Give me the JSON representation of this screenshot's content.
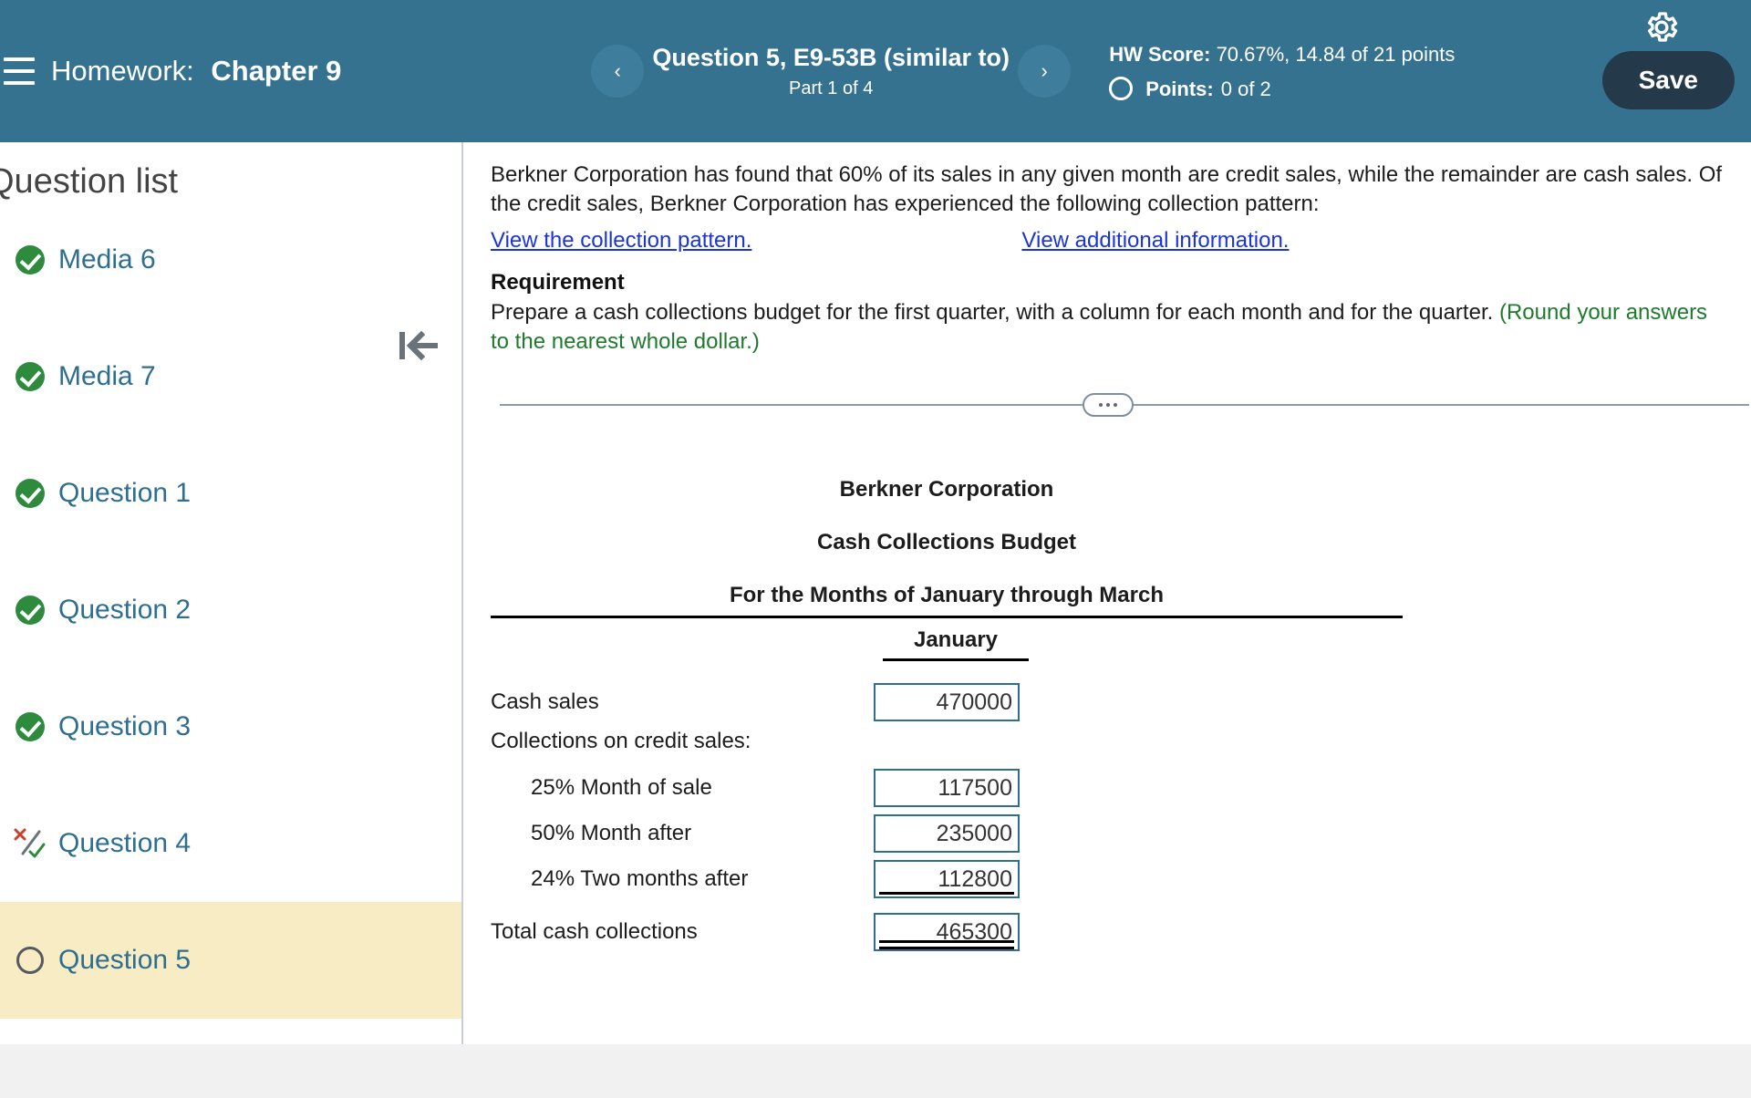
{
  "header": {
    "menu_icon": "hamburger-icon",
    "assignment_prefix": "Homework:",
    "assignment_name": "Chapter 9",
    "prev_icon": "chevron-left-icon",
    "next_icon": "chevron-right-icon",
    "question_title": "Question 5, E9-53B (similar to)",
    "question_part": "Part 1 of 4",
    "hw_score_label": "HW Score:",
    "hw_score_value": "70.67%, 14.84 of 21 points",
    "points_label": "Points:",
    "points_value": "0 of 2",
    "points_status_icon": "empty-circle-icon",
    "settings_icon": "gear-icon",
    "save_label": "Save",
    "bar_color": "#357290",
    "save_color": "#24394a"
  },
  "sidebar": {
    "title": "Question list",
    "collapse_icon": "collapse-panel-left-icon",
    "items": [
      {
        "label": "Media 6",
        "status": "correct",
        "active": false
      },
      {
        "label": "Media 7",
        "status": "correct",
        "active": false
      },
      {
        "label": "Question 1",
        "status": "correct",
        "active": false
      },
      {
        "label": "Question 2",
        "status": "correct",
        "active": false
      },
      {
        "label": "Question 3",
        "status": "correct",
        "active": false
      },
      {
        "label": "Question 4",
        "status": "partial",
        "active": false
      },
      {
        "label": "Question 5",
        "status": "unanswered",
        "active": true
      }
    ],
    "active_highlight_color": "#f7ecc4",
    "link_color": "#2e6e91",
    "correct_color": "#2e8b3d"
  },
  "question": {
    "prompt": "Berkner Corporation has found that 60% of its sales in any given month are credit sales, while the remainder are cash sales. Of the credit sales, Berkner Corporation has experienced the following collection pattern:",
    "link_1": "View the collection pattern.",
    "link_2": "View additional information.",
    "requirement_heading": "Requirement",
    "requirement_text": "Prepare a cash collections budget for the first quarter, with a column for each month and for the quarter. ",
    "requirement_note": "(Round your answers to the nearest whole dollar.)",
    "divider_icon": "ellipsis-handle-icon",
    "link_color": "#1a34d8",
    "note_color": "#1f7a2e"
  },
  "budget_table": {
    "company": "Berkner Corporation",
    "statement": "Cash Collections Budget",
    "period": "For the Months of January through March",
    "columns": [
      "January"
    ],
    "rows": [
      {
        "label": "Cash sales",
        "indent": false,
        "value": "470000",
        "rule": "none"
      },
      {
        "label": "Collections on credit sales:",
        "indent": false,
        "value": null,
        "rule": "none"
      },
      {
        "label": "25% Month of sale",
        "indent": true,
        "value": "117500",
        "rule": "none"
      },
      {
        "label": "50% Month after",
        "indent": true,
        "value": "235000",
        "rule": "none"
      },
      {
        "label": "24% Two months after",
        "indent": true,
        "value": "112800",
        "rule": "single"
      },
      {
        "label": "Total cash collections",
        "indent": false,
        "value": "465300",
        "rule": "double"
      }
    ],
    "input_border_color": "#2e6e91"
  }
}
